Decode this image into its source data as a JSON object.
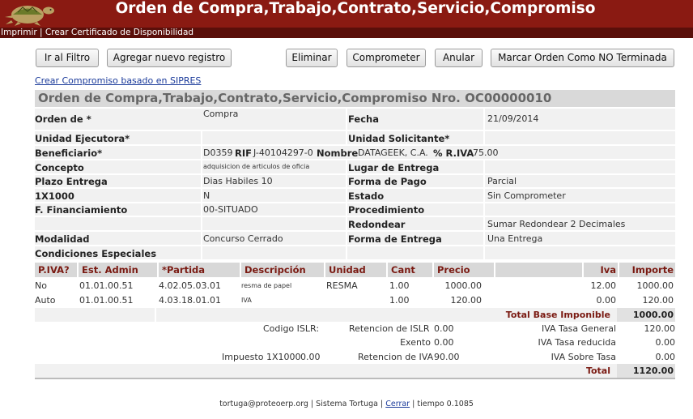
{
  "app": {
    "title": "Orden de Compra,Trabajo,Contrato,Servicio,Compromiso",
    "menu": [
      "Imprimir",
      "Crear Certificado de Disponibilidad"
    ],
    "menu_sep": "|",
    "colors": {
      "header": "#8a1a12",
      "menubar": "#5a0f0a",
      "label_header": "#7a1a12"
    }
  },
  "toolbar": {
    "filtro": "Ir al Filtro",
    "agregar": "Agregar nuevo registro",
    "eliminar": "Eliminar",
    "comprometer": "Comprometer",
    "anular": "Anular",
    "marcar": "Marcar Orden Como NO Terminada"
  },
  "link_sipres": "Crear Compromiso basado en SIPRES",
  "form": {
    "title": "Orden de Compra,Trabajo,Contrato,Servicio,Compromiso Nro. OC00000010",
    "orden_lbl": "Orden de *",
    "orden_val": "Compra",
    "fecha_lbl": "Fecha",
    "fecha_val": "21/09/2014",
    "unidad_ej_lbl": "Unidad Ejecutora*",
    "unidad_sol_lbl": "Unidad Solicitante*",
    "benef_lbl": "Beneficiario*",
    "benef_cod": "D0359",
    "rif_lbl": "RIF",
    "rif_val": "J-40104297-0",
    "nombre_lbl": "Nombre",
    "nombre_val": "DATAGEEK, C.A.",
    "riva_lbl": "% R.IVA",
    "riva_val": "75.00",
    "concepto_lbl": "Concepto",
    "concepto_val": "adquisicion de articulos de oficia",
    "lugar_lbl": "Lugar de Entrega",
    "plazo_lbl": "Plazo Entrega",
    "plazo_val": "Dias Habiles 10",
    "forma_pago_lbl": "Forma de Pago",
    "forma_pago_val": "Parcial",
    "x1000_lbl": "1X1000",
    "x1000_val": "N",
    "estado_lbl": "Estado",
    "estado_val": "Sin Comprometer",
    "financ_lbl": "F. Financiamiento",
    "financ_val": "00-SITUADO",
    "proc_lbl": "Procedimiento",
    "redondear_lbl": "Redondear",
    "redondear_val": "Sumar Redondear 2 Decimales",
    "modalidad_lbl": "Modalidad",
    "modalidad_val": "Concurso Cerrado",
    "forma_ent_lbl": "Forma de Entrega",
    "forma_ent_val": "Una Entrega",
    "cond_lbl": "Condiciones Especiales"
  },
  "items": {
    "headers": [
      "P.IVA?",
      "Est. Admin",
      "*Partida",
      "Descripción",
      "Unidad",
      "Cant",
      "Precio",
      "",
      "Iva",
      "Importe"
    ],
    "rows": [
      [
        "No",
        "01.01.00.51",
        "4.02.05.03.01",
        "resma de papel",
        "RESMA",
        "1.00",
        "1000.00",
        "",
        "12.00",
        "1000.00"
      ],
      [
        "Auto",
        "01.01.00.51",
        "4.03.18.01.01",
        "IVA",
        "",
        "1.00",
        "120.00",
        "",
        "0.00",
        "120.00"
      ]
    ]
  },
  "totals": {
    "base_lbl": "Total Base Imponible",
    "base_val": "1000.00",
    "islr_lbl": "Codigo ISLR:",
    "ret_islr_lbl": "Retencion de ISLR",
    "ret_islr_val": "0.00",
    "iva_gen_lbl": "IVA Tasa General",
    "iva_gen_val": "120.00",
    "exento_lbl": "Exento",
    "exento_val": "0.00",
    "iva_red_lbl": "IVA Tasa reducida",
    "iva_red_val": "0.00",
    "imp1000_lbl": "Impuesto 1X1000",
    "imp1000_val": "0.00",
    "ret_iva_lbl": "Retencion de IVA",
    "ret_iva_val": "90.00",
    "iva_sob_lbl": "IVA Sobre Tasa",
    "iva_sob_val": "0.00",
    "total_lbl": "Total",
    "total_val": "1120.00"
  },
  "footer": {
    "email": "tortuga@proteoerp.org",
    "system": "Sistema Tortuga",
    "cerrar": "Cerrar",
    "tiempo": "tiempo 0.1085",
    "sep": "|"
  }
}
